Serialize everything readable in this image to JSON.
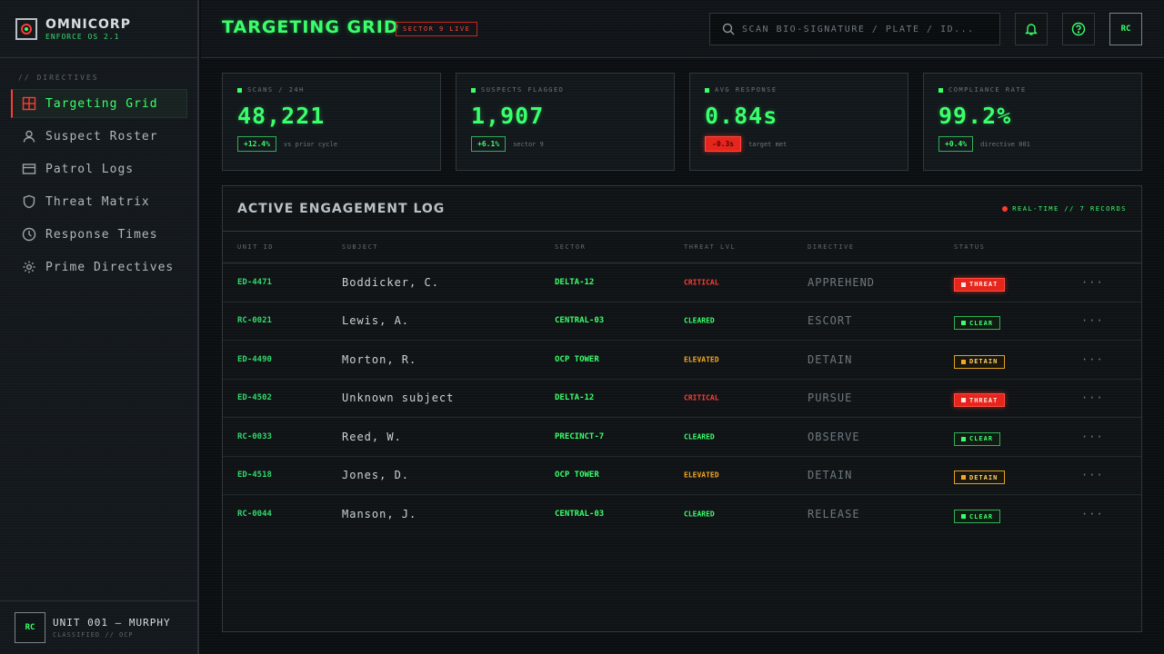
{
  "brand": {
    "name": "OMNICORP",
    "subtitle": "ENFORCE OS 2.1"
  },
  "sidebar": {
    "section_label": "// DIRECTIVES",
    "items": [
      {
        "label": "Targeting Grid",
        "icon": "grid-icon",
        "active": true
      },
      {
        "label": "Suspect Roster",
        "icon": "user-icon"
      },
      {
        "label": "Patrol Logs",
        "icon": "card-icon"
      },
      {
        "label": "Threat Matrix",
        "icon": "shield-icon"
      },
      {
        "label": "Response Times",
        "icon": "clock-icon"
      },
      {
        "label": "Prime Directives",
        "icon": "gear-icon"
      }
    ],
    "footer": {
      "avatar": "RC",
      "name": "UNIT 001 — MURPHY",
      "subtitle": "CLASSIFIED // OCP"
    }
  },
  "header": {
    "title": "TARGETING GRID",
    "badge": "SECTOR 9 LIVE",
    "search_placeholder": "SCAN BIO-SIGNATURE / PLATE / ID...",
    "avatar": "RC"
  },
  "stats": [
    {
      "label": "SCANS / 24H",
      "value": "48,221",
      "delta": "+12.4%",
      "note": "vs prior cycle",
      "negative": false
    },
    {
      "label": "SUSPECTS FLAGGED",
      "value": "1,907",
      "delta": "+6.1%",
      "note": "sector 9",
      "negative": false
    },
    {
      "label": "AVG RESPONSE",
      "value": "0.84s",
      "delta": "-0.3s",
      "note": "target met",
      "negative": true
    },
    {
      "label": "COMPLIANCE RATE",
      "value": "99.2%",
      "delta": "+0.4%",
      "note": "directive 001",
      "negative": false
    }
  ],
  "log": {
    "title": "ACTIVE ENGAGEMENT LOG",
    "status": "REAL-TIME // 7 RECORDS",
    "columns": [
      "UNIT ID",
      "SUBJECT",
      "SECTOR",
      "THREAT LVL",
      "DIRECTIVE",
      "STATUS"
    ],
    "rows": [
      {
        "unit": "ED-4471",
        "subject": "Boddicker, C.",
        "sector": "DELTA-12",
        "threat": "CRITICAL",
        "directive": "APPREHEND",
        "status": "THREAT"
      },
      {
        "unit": "RC-0021",
        "subject": "Lewis, A.",
        "sector": "CENTRAL-03",
        "threat": "CLEARED",
        "directive": "ESCORT",
        "status": "CLEAR"
      },
      {
        "unit": "ED-4490",
        "subject": "Morton, R.",
        "sector": "OCP TOWER",
        "threat": "ELEVATED",
        "directive": "DETAIN",
        "status": "DETAIN"
      },
      {
        "unit": "ED-4502",
        "subject": "Unknown subject",
        "sector": "DELTA-12",
        "threat": "CRITICAL",
        "directive": "PURSUE",
        "status": "THREAT"
      },
      {
        "unit": "RC-0033",
        "subject": "Reed, W.",
        "sector": "PRECINCT-7",
        "threat": "CLEARED",
        "directive": "OBSERVE",
        "status": "CLEAR"
      },
      {
        "unit": "ED-4518",
        "subject": "Jones, D.",
        "sector": "OCP TOWER",
        "threat": "ELEVATED",
        "directive": "DETAIN",
        "status": "DETAIN"
      },
      {
        "unit": "RC-0044",
        "subject": "Manson, J.",
        "sector": "CENTRAL-03",
        "threat": "CLEARED",
        "directive": "RELEASE",
        "status": "CLEAR"
      }
    ],
    "more_label": "···"
  },
  "colors": {
    "accent": "#39ff6a",
    "alert": "#ff3b30",
    "warning": "#f5a623",
    "background": "#0c0f12"
  }
}
